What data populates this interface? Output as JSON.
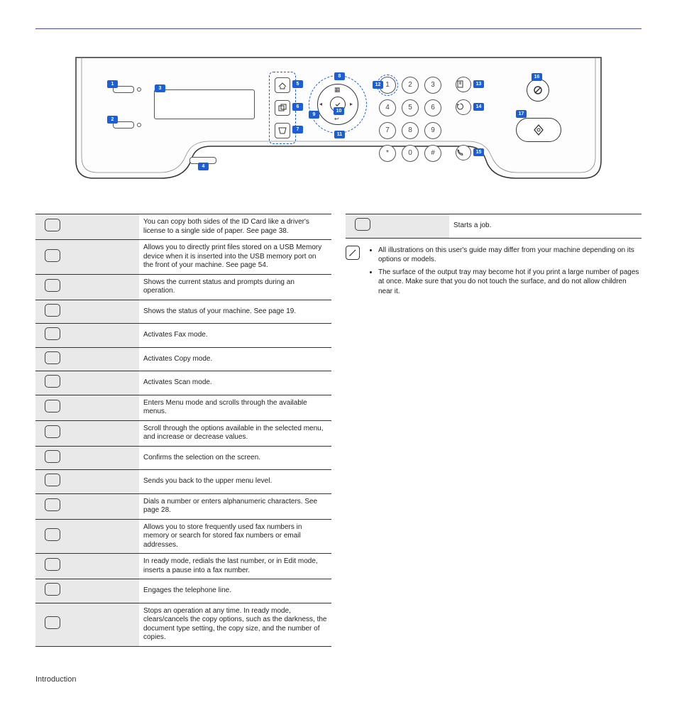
{
  "panel": {
    "callouts": [
      "1",
      "2",
      "3",
      "4",
      "5",
      "6",
      "7",
      "8",
      "9",
      "10",
      "11",
      "12",
      "13",
      "14",
      "15",
      "16",
      "17"
    ],
    "keypad": [
      "1",
      "2",
      "3",
      "4",
      "5",
      "6",
      "7",
      "8",
      "9",
      "*",
      "0",
      "#"
    ]
  },
  "left_table": [
    {
      "desc": "You can copy both sides of the ID Card like a driver's license to a single side of paper. See page 38."
    },
    {
      "desc": "Allows you to directly print files stored on a USB Memory device when it is inserted into the USB memory port on the front of your machine. See page 54."
    },
    {
      "desc": "Shows the current status and prompts during an operation."
    },
    {
      "desc": "Shows the status of your machine. See page 19."
    },
    {
      "desc": "Activates Fax mode."
    },
    {
      "desc": "Activates Copy mode."
    },
    {
      "desc": "Activates Scan mode."
    },
    {
      "desc": "Enters Menu mode and scrolls through the available menus."
    },
    {
      "desc": "Scroll through the options available in the selected menu, and increase or decrease values."
    },
    {
      "desc": "Confirms the selection on the screen."
    },
    {
      "desc": "Sends you back to the upper menu level."
    },
    {
      "desc": "Dials a number or enters alphanumeric characters. See page 28."
    },
    {
      "desc": "Allows you to store frequently used fax numbers in memory or search for stored fax numbers or email addresses."
    },
    {
      "desc": "In ready mode, redials the last number, or in Edit mode, inserts a pause into a fax number."
    },
    {
      "desc": "Engages the telephone line."
    },
    {
      "desc": "Stops an operation at any time. In ready mode, clears/cancels the copy options, such as the darkness, the document type setting, the copy size, and the number of copies."
    }
  ],
  "right_table": [
    {
      "desc": "Starts a job."
    }
  ],
  "notes": [
    "All illustrations on this user's guide may differ from your machine depending on its options or models.",
    "The surface of the output tray may become hot if you print a large number of pages at once. Make sure that you do not touch the surface, and do not allow children near it."
  ],
  "footer": "Introduction"
}
